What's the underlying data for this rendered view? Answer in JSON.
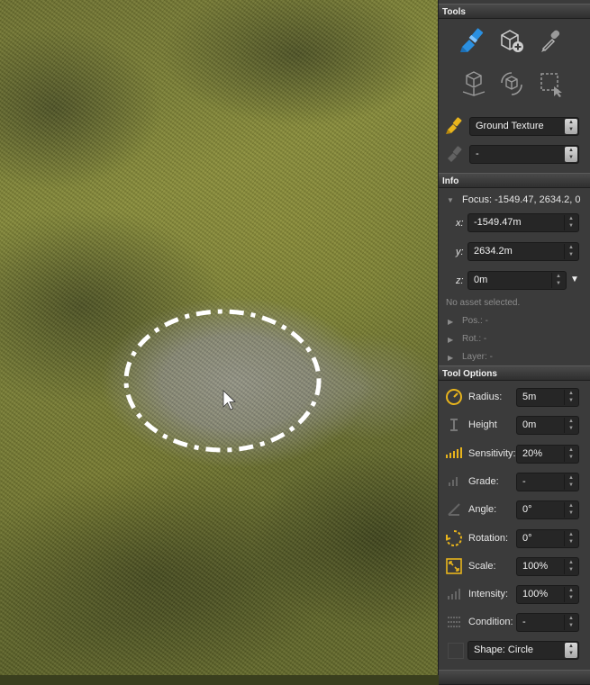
{
  "tools": {
    "header": "Tools",
    "icons": [
      "paint-brush-icon",
      "add-object-icon",
      "eyedropper-icon",
      "place-object-icon",
      "rotate-object-icon",
      "select-area-icon"
    ],
    "texture_select": "Ground Texture",
    "secondary_select": "-"
  },
  "info": {
    "header": "Info",
    "focus": "Focus: -1549.47, 2634.2, 0",
    "x_label": "x:",
    "x_value": "-1549.47m",
    "y_label": "y:",
    "y_value": "2634.2m",
    "z_label": "z:",
    "z_value": "0m",
    "no_asset": "No asset selected.",
    "pos": "Pos.: -",
    "rot": "Rot.: -",
    "layer": "Layer: -"
  },
  "tool_options": {
    "header": "Tool Options",
    "rows": [
      {
        "label": "Radius:",
        "value": "5m",
        "icon": "radius-icon",
        "enabled": true
      },
      {
        "label": "Height",
        "value": "0m",
        "icon": "height-icon",
        "enabled": false
      },
      {
        "label": "Sensitivity:",
        "value": "20%",
        "icon": "sensitivity-icon",
        "enabled": true
      },
      {
        "label": "Grade:",
        "value": "-",
        "icon": "grade-icon",
        "enabled": false
      },
      {
        "label": "Angle:",
        "value": "0°",
        "icon": "angle-icon",
        "enabled": false
      },
      {
        "label": "Rotation:",
        "value": "0°",
        "icon": "rotation-icon",
        "enabled": true
      },
      {
        "label": "Scale:",
        "value": "100%",
        "icon": "scale-icon",
        "enabled": true
      },
      {
        "label": "Intensity:",
        "value": "100%",
        "icon": "intensity-icon",
        "enabled": false
      },
      {
        "label": "Condition:",
        "value": "-",
        "icon": "condition-icon",
        "enabled": false
      }
    ],
    "shape": "Shape: Circle"
  },
  "colors": {
    "accent_blue": "#2a8fe0",
    "accent_yellow": "#e8b41c",
    "panel_bg": "#3b3b3b"
  }
}
